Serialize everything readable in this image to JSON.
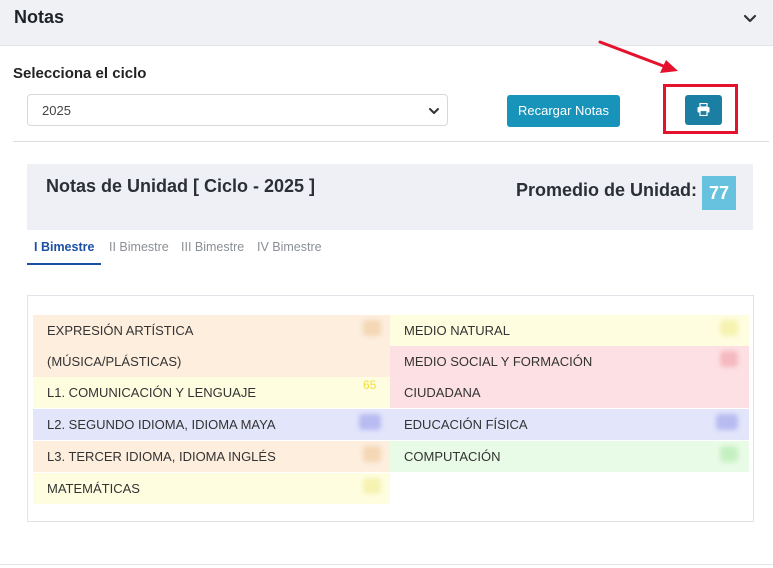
{
  "header": {
    "title": "Notas"
  },
  "cycle": {
    "label": "Selecciona el ciclo",
    "selected": "2025"
  },
  "buttons": {
    "reload_label": "Recargar Notas"
  },
  "unit": {
    "title": "Notas de Unidad [ Ciclo - 2025 ]",
    "average_label": "Promedio de Unidad:",
    "average_value": "77"
  },
  "tabs": [
    {
      "label": "I Bimestre",
      "active": true
    },
    {
      "label": "II Bimestre",
      "active": false
    },
    {
      "label": "III Bimestre",
      "active": false
    },
    {
      "label": "IV Bimestre",
      "active": false
    }
  ],
  "subjects_left": [
    {
      "name": "EXPRESIÓN ARTÍSTICA"
    },
    {
      "name": "(MÚSICA/PLÁSTICAS)"
    },
    {
      "name": "L1. COMUNICACIÓN Y LENGUAJE",
      "grade": "65"
    },
    {
      "name": "L2. SEGUNDO IDIOMA, IDIOMA MAYA"
    },
    {
      "name": "L3. TERCER IDIOMA, IDIOMA INGLÉS"
    },
    {
      "name": "MATEMÁTICAS"
    }
  ],
  "subjects_right": [
    {
      "name": "MEDIO NATURAL"
    },
    {
      "name": "MEDIO SOCIAL Y FORMACIÓN"
    },
    {
      "name": "CIUDADANA"
    },
    {
      "name": "EDUCACIÓN FÍSICA"
    },
    {
      "name": "COMPUTACIÓN"
    }
  ],
  "colors": {
    "orange_row": "#fdeede",
    "yellow_row": "#fefde0",
    "red_row": "#fde0e3",
    "blue_row": "#e3e5fb",
    "green_row": "#e8fbe6",
    "reload_button": "#1893ba",
    "print_button": "#1a7fa2",
    "highlight": "#e5122e",
    "average_badge": "#66c2df"
  },
  "icons": {
    "header_toggle": "chevron-down-icon",
    "select_toggle": "chevron-down-icon",
    "print": "printer-icon",
    "annotation": "red-arrow-icon"
  }
}
